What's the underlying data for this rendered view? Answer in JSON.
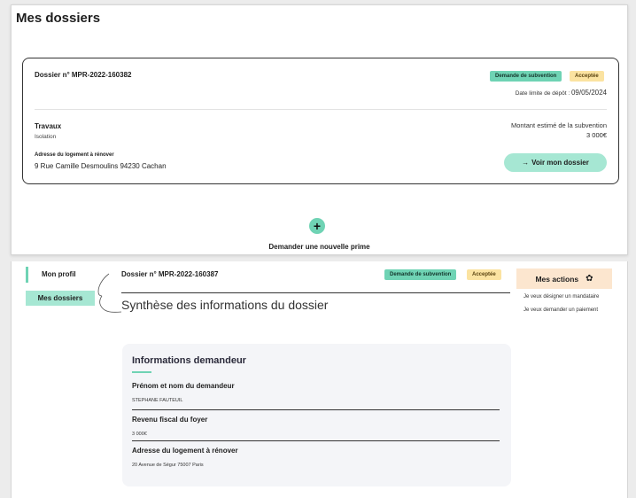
{
  "top": {
    "page_title": "Mes dossiers",
    "dossier": {
      "number": "Dossier n° MPR-2022-160382",
      "badge_type": "Demande de subvention",
      "badge_status": "Acceptée",
      "deadline_label": "Date limite de dépôt :",
      "deadline_date": "09/05/2024",
      "travaux_label": "Travaux",
      "travaux_value": "Isolation",
      "address_label": "Adresse du logement à rénover",
      "address_value": "9 Rue Camille Desmoulins 94230 Cachan",
      "montant_label": "Montant estimé de la subvention",
      "montant_value": "3 000€",
      "button_arrow": "→",
      "button_label": "Voir mon dossier"
    },
    "add_icon": "+",
    "add_label": "Demander une nouvelle prime"
  },
  "sidebar": {
    "items": [
      {
        "label": "Mon profil"
      },
      {
        "label": "Mes dossiers"
      }
    ]
  },
  "detail": {
    "number": "Dossier n° MPR-2022-160387",
    "badge_type": "Demande de subvention",
    "badge_status": "Acceptée",
    "title": "Synthèse des informations du dossier"
  },
  "actions": {
    "title": "Mes actions",
    "gear_icon": "✿",
    "items": [
      {
        "label": "Je veux désigner un mandataire"
      },
      {
        "label": "Je veux demander un paiement"
      }
    ]
  },
  "info": {
    "title": "Informations demandeur",
    "fields": [
      {
        "label": "Prénom et nom du demandeur",
        "value": "STEPHANE FAUTEUIL"
      },
      {
        "label": "Revenu fiscal du foyer",
        "value": "3 000€"
      },
      {
        "label": "Adresse du logement à rénover",
        "value": "20 Avenue de Ségur 75007 Paris"
      }
    ]
  },
  "colors": {
    "accent_green": "#6fd3b4",
    "light_green": "#a6e7d3",
    "badge_yellow": "#fbe3a1",
    "actions_peach": "#fce6cf",
    "info_card_bg": "#f4f5f8"
  }
}
